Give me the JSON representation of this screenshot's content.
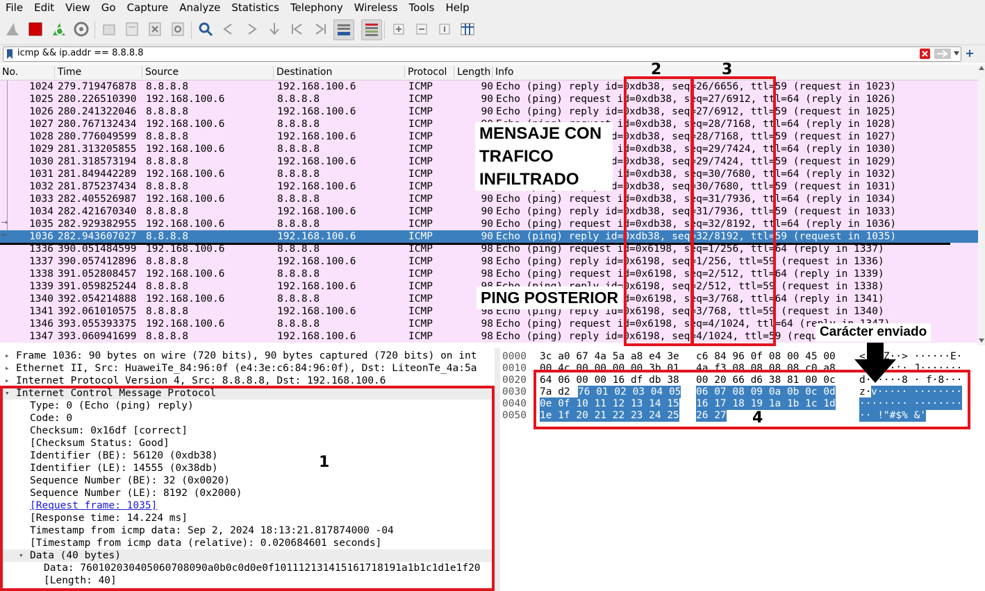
{
  "menu": [
    {
      "label": "File"
    },
    {
      "label": "Edit"
    },
    {
      "label": "View"
    },
    {
      "label": "Go"
    },
    {
      "label": "Capture"
    },
    {
      "label": "Analyze"
    },
    {
      "label": "Statistics"
    },
    {
      "label": "Telephony"
    },
    {
      "label": "Wireless"
    },
    {
      "label": "Tools"
    },
    {
      "label": "Help"
    }
  ],
  "filter": {
    "value": "icmp && ip.addr == 8.8.8.8"
  },
  "columns": [
    "No.",
    "Time",
    "Source",
    "Destination",
    "Protocol",
    "Length",
    "Info"
  ],
  "packets": [
    {
      "no": "1024",
      "time": "279.719476878",
      "src": "8.8.8.8",
      "dst": "192.168.100.6",
      "proto": "ICMP",
      "len": "90",
      "info": "Echo (ping) reply    id=0xdb38, seq=26/6656, ttl=59 (request in 1023)"
    },
    {
      "no": "1025",
      "time": "280.226510390",
      "src": "192.168.100.6",
      "dst": "8.8.8.8",
      "proto": "ICMP",
      "len": "90",
      "info": "Echo (ping) request  id=0xdb38, seq=27/6912, ttl=64 (reply in 1026)"
    },
    {
      "no": "1026",
      "time": "280.241322046",
      "src": "8.8.8.8",
      "dst": "192.168.100.6",
      "proto": "ICMP",
      "len": "90",
      "info": "Echo (ping) reply    id=0xdb38, seq=27/6912, ttl=59 (request in 1025)"
    },
    {
      "no": "1027",
      "time": "280.767132434",
      "src": "192.168.100.6",
      "dst": "8.8.8.8",
      "proto": "ICMP",
      "len": "90",
      "info": "Echo (ping) request  id=0xdb38, seq=28/7168, ttl=64 (reply in 1028)"
    },
    {
      "no": "1028",
      "time": "280.776049599",
      "src": "8.8.8.8",
      "dst": "192.168.100.6",
      "proto": "ICMP",
      "len": "90",
      "info": "Echo (ping) reply    id=0xdb38, seq=28/7168, ttl=59 (request in 1027)"
    },
    {
      "no": "1029",
      "time": "281.313205855",
      "src": "192.168.100.6",
      "dst": "8.8.8.8",
      "proto": "ICMP",
      "len": "90",
      "info": "Echo (ping) request  id=0xdb38, seq=29/7424, ttl=64 (reply in 1030)"
    },
    {
      "no": "1030",
      "time": "281.318573194",
      "src": "8.8.8.8",
      "dst": "192.168.100.6",
      "proto": "ICMP",
      "len": "90",
      "info": "Echo (ping) reply    id=0xdb38, seq=29/7424, ttl=59 (request in 1029)"
    },
    {
      "no": "1031",
      "time": "281.849442289",
      "src": "192.168.100.6",
      "dst": "8.8.8.8",
      "proto": "ICMP",
      "len": "90",
      "info": "Echo (ping) request  id=0xdb38, seq=30/7680, ttl=64 (reply in 1032)"
    },
    {
      "no": "1032",
      "time": "281.875237434",
      "src": "8.8.8.8",
      "dst": "192.168.100.6",
      "proto": "ICMP",
      "len": "90",
      "info": "Echo (ping) reply    id=0xdb38, seq=30/7680, ttl=59 (request in 1031)"
    },
    {
      "no": "1033",
      "time": "282.405526987",
      "src": "192.168.100.6",
      "dst": "8.8.8.8",
      "proto": "ICMP",
      "len": "90",
      "info": "Echo (ping) request  id=0xdb38, seq=31/7936, ttl=64 (reply in 1034)"
    },
    {
      "no": "1034",
      "time": "282.421670340",
      "src": "8.8.8.8",
      "dst": "192.168.100.6",
      "proto": "ICMP",
      "len": "90",
      "info": "Echo (ping) reply    id=0xdb38, seq=31/7936, ttl=59 (request in 1033)"
    },
    {
      "no": "1035",
      "time": "282.929382955",
      "src": "192.168.100.6",
      "dst": "8.8.8.8",
      "proto": "ICMP",
      "len": "90",
      "info": "Echo (ping) request  id=0xdb38, seq=32/8192, ttl=64 (reply in 1036)"
    },
    {
      "no": "1036",
      "time": "282.943607027",
      "src": "8.8.8.8",
      "dst": "192.168.100.6",
      "proto": "ICMP",
      "len": "90",
      "info": "Echo (ping) reply    id=0xdb38, seq=32/8192, ttl=59 (request in 1035)"
    },
    {
      "no": "1336",
      "time": "390.051484599",
      "src": "192.168.100.6",
      "dst": "8.8.8.8",
      "proto": "ICMP",
      "len": "98",
      "info": "Echo (ping) request  id=0x6198, seq=1/256, ttl=64 (reply in 1337)"
    },
    {
      "no": "1337",
      "time": "390.057412896",
      "src": "8.8.8.8",
      "dst": "192.168.100.6",
      "proto": "ICMP",
      "len": "98",
      "info": "Echo (ping) reply    id=0x6198, seq=1/256, ttl=59 (request in 1336)"
    },
    {
      "no": "1338",
      "time": "391.052808457",
      "src": "192.168.100.6",
      "dst": "8.8.8.8",
      "proto": "ICMP",
      "len": "98",
      "info": "Echo (ping) request  id=0x6198, seq=2/512, ttl=64 (reply in 1339)"
    },
    {
      "no": "1339",
      "time": "391.059825244",
      "src": "8.8.8.8",
      "dst": "192.168.100.6",
      "proto": "ICMP",
      "len": "98",
      "info": "Echo (ping) reply    id=0x6198, seq=2/512, ttl=59 (request in 1338)"
    },
    {
      "no": "1340",
      "time": "392.054214888",
      "src": "192.168.100.6",
      "dst": "8.8.8.8",
      "proto": "ICMP",
      "len": "98",
      "info": "Echo (ping) request  id=0x6198, seq=3/768, ttl=64 (reply in 1341)"
    },
    {
      "no": "1341",
      "time": "392.061010575",
      "src": "8.8.8.8",
      "dst": "192.168.100.6",
      "proto": "ICMP",
      "len": "98",
      "info": "Echo (ping) reply    id=0x6198, seq=3/768, ttl=59 (request in 1340)"
    },
    {
      "no": "1346",
      "time": "393.055393375",
      "src": "192.168.100.6",
      "dst": "8.8.8.8",
      "proto": "ICMP",
      "len": "98",
      "info": "Echo (ping) request  id=0x6198, seq=4/1024, ttl=64 (reply in 1347)"
    },
    {
      "no": "1347",
      "time": "393.060941699",
      "src": "8.8.8.8",
      "dst": "192.168.100.6",
      "proto": "ICMP",
      "len": "98",
      "info": "Echo (ping) reply    id=0x6198, seq=4/1024, ttl=59 (request in 1346)"
    }
  ],
  "details": {
    "frame": "Frame 1036: 90 bytes on wire (720 bits), 90 bytes captured (720 bits) on int",
    "ethernet": "Ethernet II, Src: HuaweiTe_84:96:0f (e4:3e:c6:84:96:0f), Dst: LiteonTe_4a:5a",
    "ip": "Internet Protocol Version 4, Src: 8.8.8.8, Dst: 192.168.100.6",
    "icmp": "Internet Control Message Protocol",
    "type": "Type: 0 (Echo (ping) reply)",
    "code": "Code: 0",
    "checksum": "Checksum: 0x16df [correct]",
    "checksum_status": "[Checksum Status: Good]",
    "id_be": "Identifier (BE): 56120 (0xdb38)",
    "id_le": "Identifier (LE): 14555 (0x38db)",
    "seq_be": "Sequence Number (BE): 32 (0x0020)",
    "seq_le": "Sequence Number (LE): 8192 (0x2000)",
    "request_frame": "[Request frame: 1035]",
    "response_time": "[Response time: 14.224 ms]",
    "timestamp": "Timestamp from icmp data: Sep  2, 2024 18:13:21.817874000 -04",
    "timestamp_rel": "[Timestamp from icmp data (relative): 0.020684601 seconds]",
    "data": "Data (40 bytes)",
    "data_hex": "Data: 760102030405060708090a0b0c0d0e0f101112131415161718191a1b1c1d1e1f20",
    "length": "[Length: 40]"
  },
  "hex": {
    "rows": [
      {
        "off": "0000",
        "a": "3c a0 67 4a 5a a8 e4 3e",
        "b": "c6 84 96 0f 08 00 45 00",
        "ascii": "<·gJZ··> ······E·"
      },
      {
        "off": "0010",
        "a": "00 4c 00 00 00 00 3b 01",
        "b": "4a f3 08 08 08 08 c0 a8",
        "ascii": "·L····;· J·······"
      },
      {
        "off": "0020",
        "a": "64 06 00 00 16 df db 38",
        "b": "00 20 66 d6 38 81 00 0c",
        "ascii": "d······8 · f·8···"
      },
      {
        "off": "0030",
        "a": "7a d2",
        "a_sel": "76 01 02 03 04 05",
        "b": "06 07 08 09 0a 0b 0c 0d",
        "ascii": "z·",
        "ascii_sel": "v····· ········"
      },
      {
        "off": "0040",
        "a_sel": "0e 0f 10 11 12 13 14 15",
        "b": "16 17 18 19 1a 1b 1c 1d",
        "ascii_sel": "········ ········"
      },
      {
        "off": "0050",
        "a_sel": "1e 1f 20 21 22 23 24 25",
        "b": "26 27",
        "ascii_sel": "·· !\"#$% &'"
      }
    ]
  },
  "annotations": {
    "n1": "1",
    "n2": "2",
    "n3": "3",
    "n4": "4",
    "mensaje": "MENSAJE CON TRAFICO INFILTRADO",
    "ping": "PING POSTERIOR",
    "caracter": "Carácter enviado",
    "color": "#e3141e"
  },
  "colors": {
    "row_bg": "#fbe2fc",
    "selected": "#3b7fbf"
  }
}
